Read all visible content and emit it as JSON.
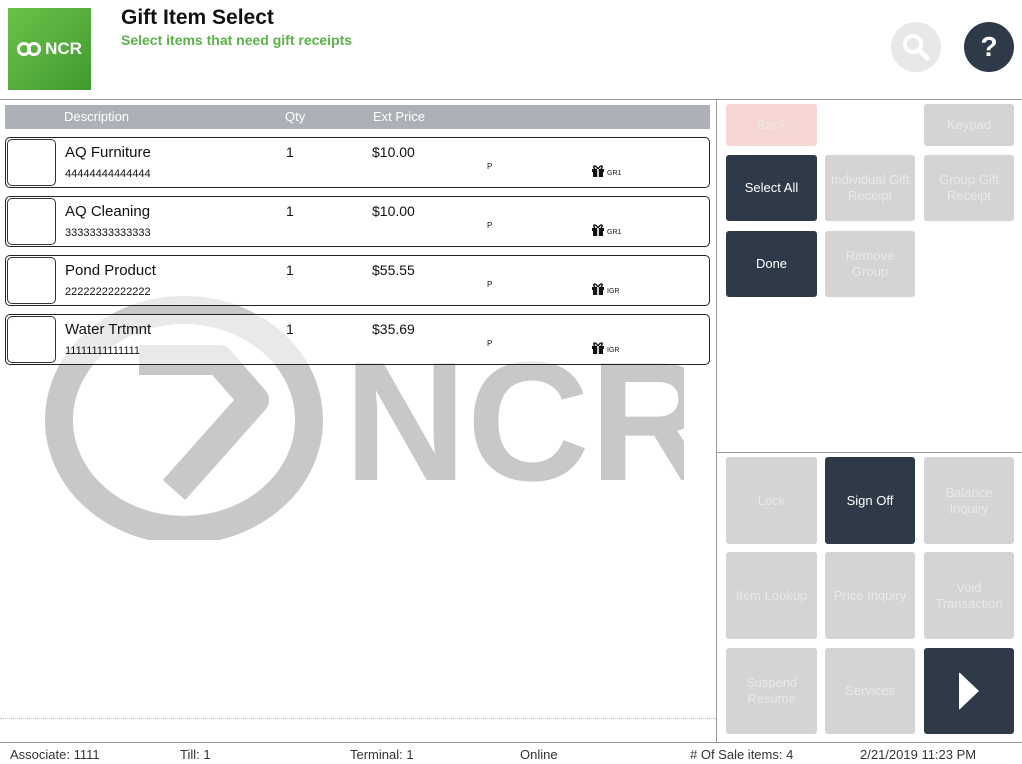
{
  "header": {
    "logo_text": "NCR",
    "title": "Gift Item Select",
    "subtitle": "Select items that need gift receipts",
    "search_icon": "search-icon",
    "help_label": "?"
  },
  "columns": {
    "description": "Description",
    "qty": "Qty",
    "ext_price": "Ext Price"
  },
  "items": [
    {
      "description": "AQ Furniture",
      "code": "44444444444444",
      "qty": "1",
      "price": "$10.00",
      "flag": "P",
      "gift_code": "GR1"
    },
    {
      "description": "AQ Cleaning",
      "code": "33333333333333",
      "qty": "1",
      "price": "$10.00",
      "flag": "P",
      "gift_code": "GR1"
    },
    {
      "description": "Pond Product",
      "code": "22222222222222",
      "qty": "1",
      "price": "$55.55",
      "flag": "P",
      "gift_code": "IGR"
    },
    {
      "description": "Water Trtmnt",
      "code": "11111111111111",
      "qty": "1",
      "price": "$35.69",
      "flag": "P",
      "gift_code": "IGR"
    }
  ],
  "watermark_text": "NCR",
  "actions": {
    "back": "Back",
    "keypad": "Keypad",
    "select_all": "Select All",
    "individual_gift_receipt": "Individual Gift Receipt",
    "group_gift_receipt": "Group Gift Receipt",
    "done": "Done",
    "remove_group": "Remove Group"
  },
  "global_actions": {
    "lock": "Lock",
    "sign_off": "Sign Off",
    "balance_inquiry": "Balance Inquiry",
    "item_lookup": "Item Lookup",
    "price_inquiry": "Price Inquiry",
    "void_transaction": "Void Transaction",
    "suspend_resume": "Suspend Resume",
    "services": "Services",
    "next_icon": "chevron-right-icon"
  },
  "status": {
    "associate": "Associate: 1111",
    "till": "Till: 1",
    "terminal": "Terminal: 1",
    "connection": "Online",
    "sale_items": "# Of Sale items: 4",
    "datetime": "2/21/2019 11:23 PM"
  },
  "colors": {
    "accent_green": "#5bb14a",
    "dark_button": "#2f3a48",
    "disabled_button": "#d4d4d4",
    "header_row": "#adb1b7"
  }
}
